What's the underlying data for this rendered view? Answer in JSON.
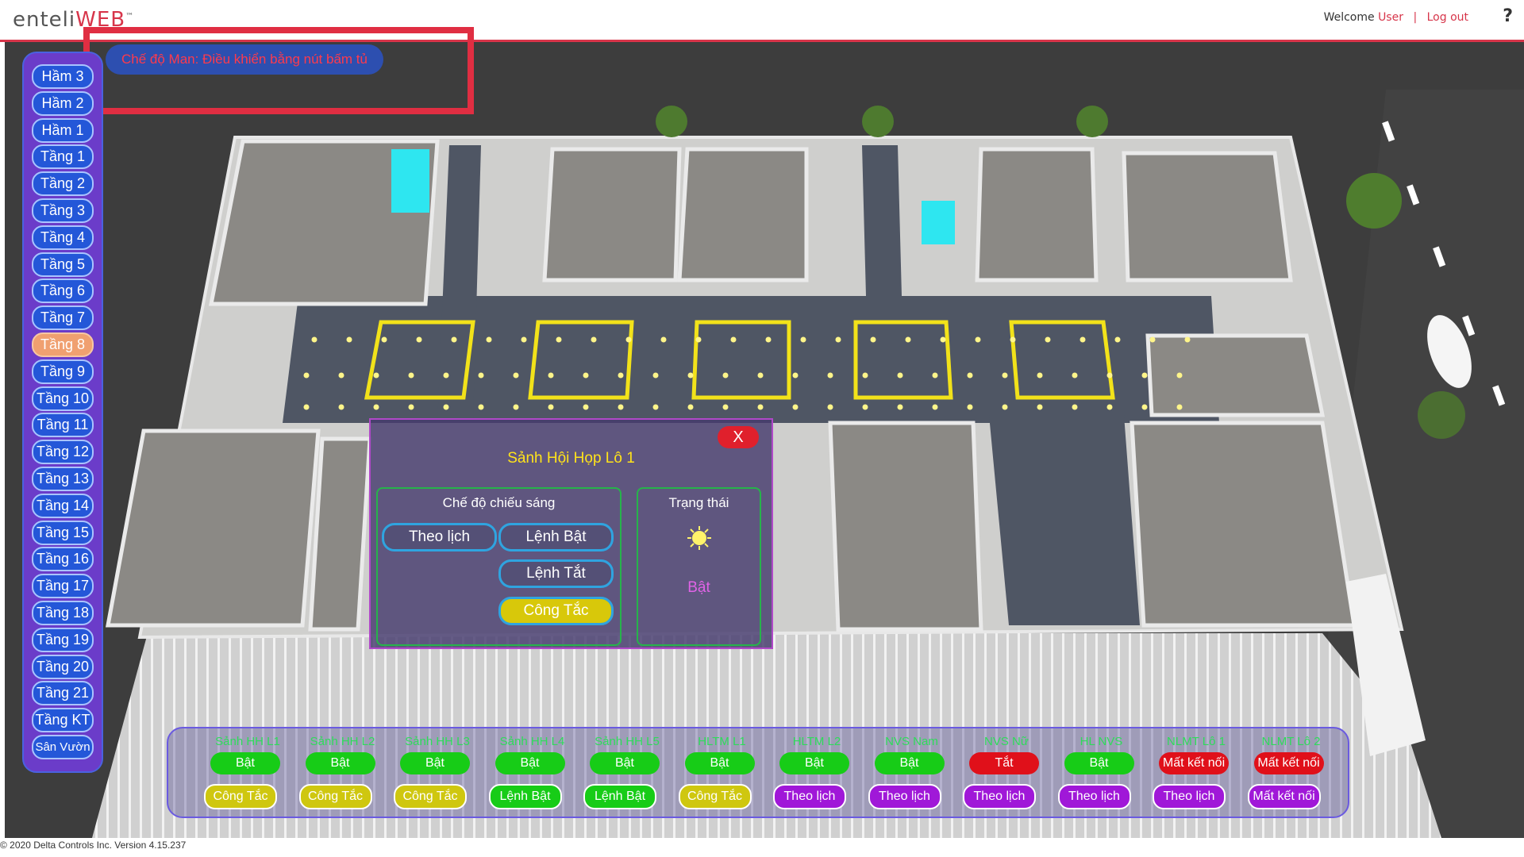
{
  "header": {
    "logo_main": "enteli",
    "logo_web": "WEB",
    "logo_tm": "™",
    "welcome": "Welcome",
    "user": "User",
    "separator": "|",
    "logout": "Log out",
    "help": "?"
  },
  "mode_banner": "Chế độ Man: Điều khiển bằng nút bấm tủ",
  "floors": [
    "Hầm 3",
    "Hầm 2",
    "Hầm 1",
    "Tầng 1",
    "Tầng 2",
    "Tầng 3",
    "Tầng 4",
    "Tầng 5",
    "Tầng 6",
    "Tầng 7",
    "Tầng 8",
    "Tầng 9",
    "Tầng 10",
    "Tầng 11",
    "Tầng 12",
    "Tầng 13",
    "Tầng 14",
    "Tầng 15",
    "Tầng 16",
    "Tầng 17",
    "Tầng 18",
    "Tầng 19",
    "Tầng 20",
    "Tầng 21",
    "Tầng KT",
    "Sân Vườn"
  ],
  "active_floor": "Tầng 8",
  "panel": {
    "close": "X",
    "title": "Sảnh Hội Họp Lô 1",
    "mode_label": "Chế độ chiếu sáng",
    "btn_schedule": "Theo lịch",
    "btn_on": "Lệnh Bật",
    "btn_off": "Lệnh Tắt",
    "btn_switch": "Công Tắc",
    "status_label": "Trạng thái",
    "status_value": "Bật"
  },
  "zones": [
    {
      "name": "Sảnh HH L1",
      "state": "Bật",
      "mode": "Công Tắc"
    },
    {
      "name": "Sảnh HH L2",
      "state": "Bật",
      "mode": "Công Tắc"
    },
    {
      "name": "Sảnh HH L3",
      "state": "Bật",
      "mode": "Công Tắc"
    },
    {
      "name": "Sảnh HH L4",
      "state": "Bật",
      "mode": "Lệnh Bật"
    },
    {
      "name": "Sảnh HH L5",
      "state": "Bật",
      "mode": "Lệnh Bật"
    },
    {
      "name": "HLTM L1",
      "state": "Bật",
      "mode": "Công Tắc"
    },
    {
      "name": "HLTM L2",
      "state": "Bật",
      "mode": "Theo lịch"
    },
    {
      "name": "NVS Nam",
      "state": "Bật",
      "mode": "Theo lịch"
    },
    {
      "name": "NVS Nữ",
      "state": "Tắt",
      "mode": "Theo lịch"
    },
    {
      "name": "HL NVS",
      "state": "Bật",
      "mode": "Theo lịch"
    },
    {
      "name": "NLMT Lô 1",
      "state": "Mất kết nối",
      "mode": "Theo lịch"
    },
    {
      "name": "NLMT Lô 2",
      "state": "Mất kết nối",
      "mode": "Mất kết nối"
    }
  ],
  "footer": "© 2020 Delta Controls Inc. Version 4.15.237",
  "colors": {
    "accent": "#d7354a",
    "floor_button": "#2457d8",
    "active_floor": "#f0a070",
    "status_on": "#17cc17",
    "status_off": "#e0101a",
    "switch_mode": "#cfc70f",
    "schedule_mode": "#a018d8"
  }
}
